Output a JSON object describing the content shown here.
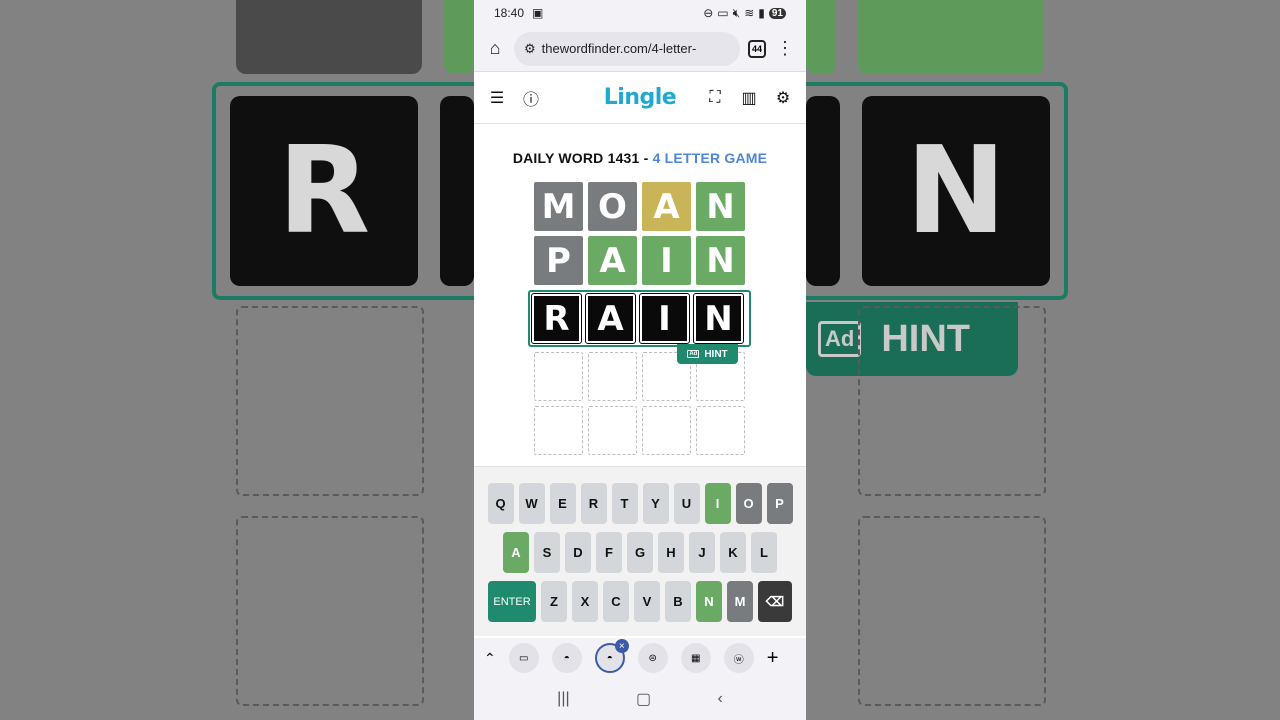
{
  "status": {
    "time": "18:40",
    "battery": "91"
  },
  "browser": {
    "url": "thewordfinder.com/4-letter-",
    "tab_count": "44"
  },
  "app": {
    "logo": "Lingle"
  },
  "game": {
    "title_prefix": "DAILY WORD 1431 -",
    "title_accent": "4 LETTER GAME",
    "rows": [
      [
        {
          "l": "M",
          "s": "gray"
        },
        {
          "l": "O",
          "s": "gray"
        },
        {
          "l": "A",
          "s": "yellow"
        },
        {
          "l": "N",
          "s": "green"
        }
      ],
      [
        {
          "l": "P",
          "s": "gray"
        },
        {
          "l": "A",
          "s": "green"
        },
        {
          "l": "I",
          "s": "green"
        },
        {
          "l": "N",
          "s": "green"
        }
      ],
      [
        {
          "l": "R",
          "s": "black"
        },
        {
          "l": "A",
          "s": "black"
        },
        {
          "l": "I",
          "s": "black"
        },
        {
          "l": "N",
          "s": "black"
        }
      ],
      [
        {
          "l": "",
          "s": "empty"
        },
        {
          "l": "",
          "s": "empty"
        },
        {
          "l": "",
          "s": "empty"
        },
        {
          "l": "",
          "s": "empty"
        }
      ],
      [
        {
          "l": "",
          "s": "empty"
        },
        {
          "l": "",
          "s": "empty"
        },
        {
          "l": "",
          "s": "empty"
        },
        {
          "l": "",
          "s": "empty"
        }
      ]
    ],
    "hint_label": "HINT",
    "hint_ad": "Ad"
  },
  "keyboard": {
    "row1": [
      {
        "k": "Q"
      },
      {
        "k": "W"
      },
      {
        "k": "E"
      },
      {
        "k": "R"
      },
      {
        "k": "T"
      },
      {
        "k": "Y"
      },
      {
        "k": "U"
      },
      {
        "k": "I",
        "s": "green"
      },
      {
        "k": "O",
        "s": "gray"
      },
      {
        "k": "P",
        "s": "gray"
      }
    ],
    "row2": [
      {
        "k": "A",
        "s": "green"
      },
      {
        "k": "S"
      },
      {
        "k": "D"
      },
      {
        "k": "F"
      },
      {
        "k": "G"
      },
      {
        "k": "H"
      },
      {
        "k": "J"
      },
      {
        "k": "K"
      },
      {
        "k": "L"
      }
    ],
    "row3": [
      {
        "k": "ENTER",
        "s": "enter"
      },
      {
        "k": "Z"
      },
      {
        "k": "X"
      },
      {
        "k": "C"
      },
      {
        "k": "V"
      },
      {
        "k": "B"
      },
      {
        "k": "N",
        "s": "green"
      },
      {
        "k": "M",
        "s": "gray"
      },
      {
        "k": "⌫",
        "s": "back"
      }
    ]
  },
  "background": {
    "letters": [
      "R",
      "N"
    ],
    "hint_label": "HINT",
    "hint_ad": "Ad"
  },
  "colors": {
    "green": "#6aaa64",
    "yellow": "#c9b458",
    "gray": "#787c7e",
    "accent": "#1f8a6e",
    "logo": "#1fa8d2"
  }
}
